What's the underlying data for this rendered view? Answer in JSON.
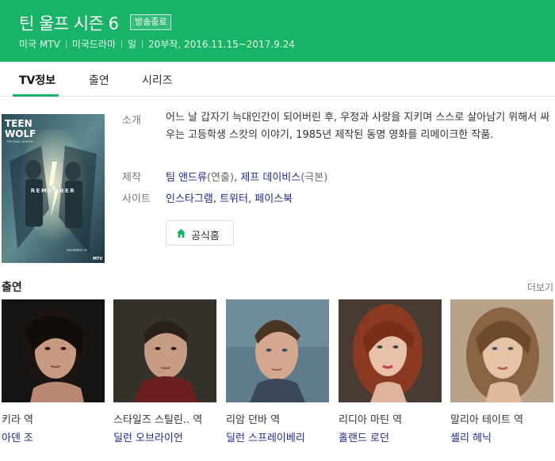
{
  "header": {
    "title": "틴 울프 시즌 6",
    "badge": "방송종료",
    "meta": [
      "미국 MTV",
      "미국드라마",
      "일",
      "20부작, 2016.11.15~2017.9.24"
    ],
    "bg_color": "#19b368"
  },
  "tabs": [
    {
      "label": "TV정보",
      "active": true
    },
    {
      "label": "출연",
      "active": false
    },
    {
      "label": "시리즈",
      "active": false
    }
  ],
  "poster": {
    "title_line1": "TEEN",
    "title_line2": "WOLF",
    "subtitle": "THE FINAL SEASON",
    "tagline": "REMEMBER",
    "date": "NOVEMBER 15",
    "network": "MTV"
  },
  "info": {
    "intro_label": "소개",
    "intro_text": "어느 날 갑자기 늑대인간이 되어버린 후, 우정과 사랑을 지키며 스스로 살아남기 위해서 싸우는 고등학생 스캇의 이야기, 1985년 제작된 동명 영화를 리메이크한 작품.",
    "production_label": "제작",
    "production": [
      {
        "name": "팀 앤드류",
        "role": "(연출)"
      },
      {
        "name": "제프 데이비스",
        "role": "(극본)"
      }
    ],
    "site_label": "사이트",
    "sites": [
      "인스타그램",
      "트위터",
      "페이스북"
    ],
    "official_button": "공식홈",
    "official_icon": "home-icon"
  },
  "cast": {
    "title": "출연",
    "more": "더보기",
    "members": [
      {
        "role": "키라 역",
        "actor": "아덴 조"
      },
      {
        "role": "스타일즈 스틸린.. 역",
        "actor": "딜런 오브라이언"
      },
      {
        "role": "리암 던바 역",
        "actor": "딜런 스프레이베리"
      },
      {
        "role": "리디아 마틴 역",
        "actor": "홀랜드 로던"
      },
      {
        "role": "말리아 테이트 역",
        "actor": "셸리 헤닉"
      }
    ]
  },
  "colors": {
    "accent": "#19b368",
    "link": "#1e2a8c"
  }
}
